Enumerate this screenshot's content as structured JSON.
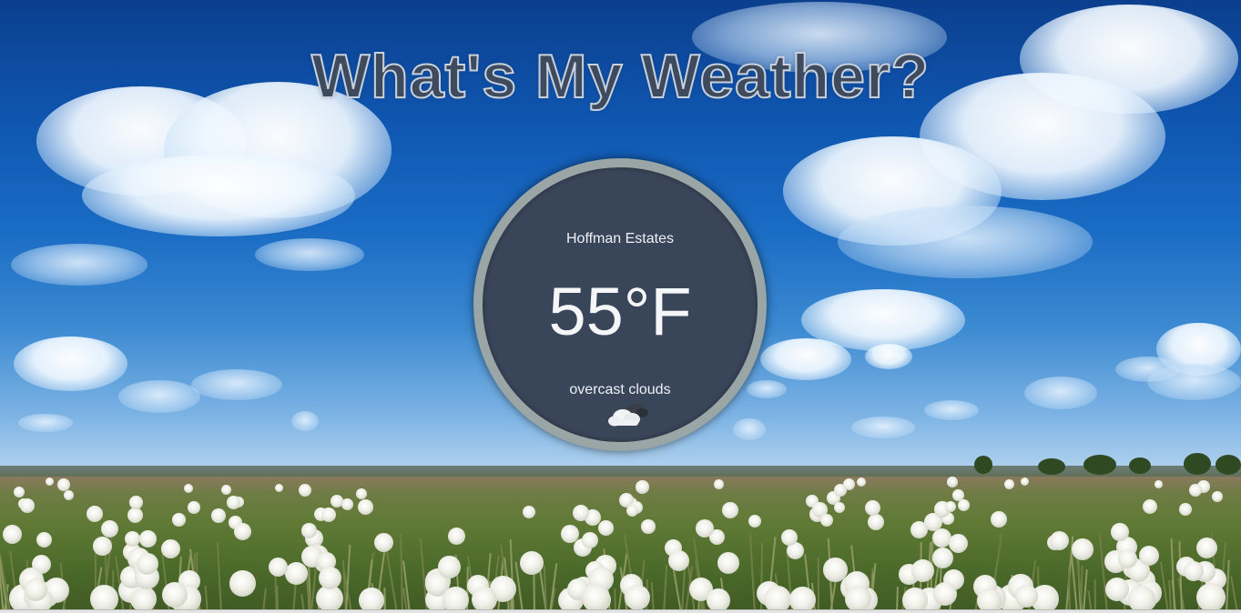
{
  "page": {
    "title": "What's My Weather?"
  },
  "weather": {
    "city": "Hoffman Estates",
    "temperature": "55°F",
    "description": "overcast clouds",
    "icon": "broken-clouds-icon"
  },
  "colors": {
    "card_background": "#394559",
    "card_border": "#9aa5a5",
    "title_fill": "#3e4a5d",
    "title_outline": "#c9d1dc",
    "text": "#eef2f6"
  }
}
